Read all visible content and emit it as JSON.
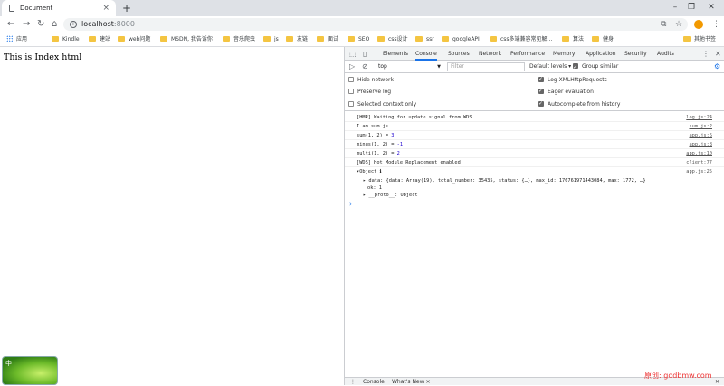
{
  "browser": {
    "tab_title": "Document",
    "url_host": "localhost",
    "url_port": ":8000"
  },
  "bookmarks": {
    "apps_label": "应用",
    "items": [
      "Kindle",
      "建站",
      "web问题",
      "MSDN, 我告诉你",
      "音乐爬虫",
      "js",
      "友链",
      "面试",
      "SEO",
      "css设计",
      "ssr",
      "googleAPI",
      "css多端兼容常见解…",
      "算法",
      "健身"
    ],
    "other_label": "其他书签"
  },
  "page": {
    "text": "This is Index html",
    "leaf_text": "中"
  },
  "devtools": {
    "tabs": [
      "Elements",
      "Console",
      "Sources",
      "Network",
      "Performance",
      "Memory",
      "Application",
      "Security",
      "Audits"
    ],
    "active_tab": "Console",
    "context": "top",
    "filter_placeholder": "Filter",
    "levels_label": "Default levels ▾",
    "group_similar": "Group similar",
    "settings": {
      "hide_network": "Hide network",
      "preserve_log": "Preserve log",
      "selected_context": "Selected context only",
      "log_xhr": "Log XMLHttpRequests",
      "eager_eval": "Eager evaluation",
      "autocomplete": "Autocomplete from history"
    },
    "console_lines": [
      {
        "text": "[HMR] Waiting for update signal from WDS...",
        "src": "log.js:24"
      },
      {
        "text": "I am sum.js",
        "src": "sum.js:2"
      },
      {
        "text": "sum(1, 2) =  ",
        "num": "3",
        "src": "app.js:6"
      },
      {
        "text": "minus(1, 2) =  ",
        "num": "-1",
        "src": "app.js:8"
      },
      {
        "text": "multi(1, 2) =  ",
        "num": "2",
        "src": "app.js:10"
      },
      {
        "text": "[WDS] Hot Module Replacement enabled.",
        "src": "client:77"
      },
      {
        "text": "▾Object ℹ",
        "src": "app.js:25"
      }
    ],
    "object_data": "▸ data: {data: Array(19), total_number: 35435, status: {…}, max_id: 176761971443084, max: 1772, …}",
    "object_ok": "ok: 1",
    "object_proto": "▸ __proto__: Object",
    "drawer_tabs": [
      "Console",
      "What's New ×"
    ]
  },
  "watermark": "原创: godbmw.com"
}
